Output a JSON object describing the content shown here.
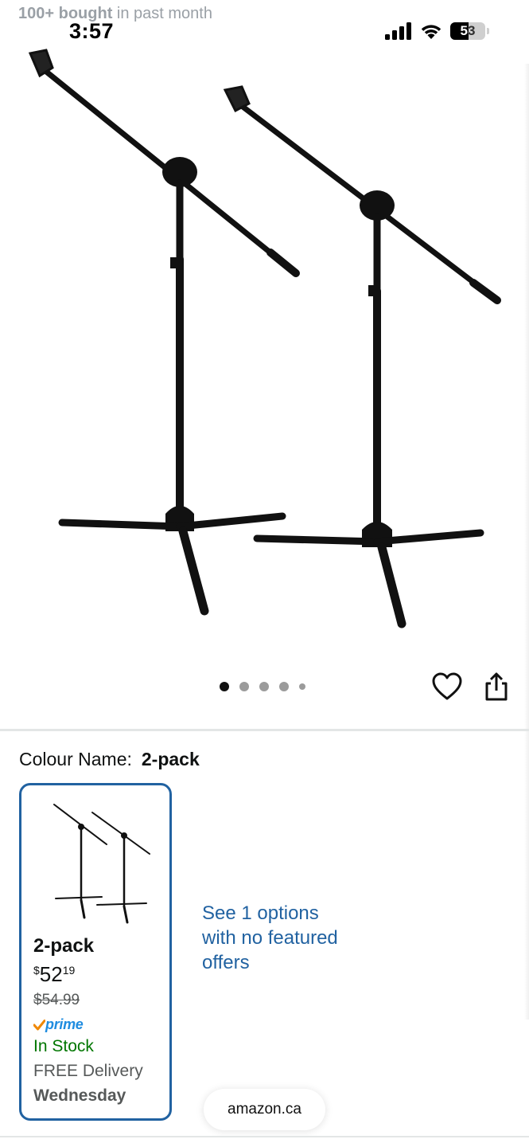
{
  "status_bar": {
    "time": "3:57",
    "battery": "53"
  },
  "social_proof": {
    "count": "100+ bought",
    "rest": " in past month"
  },
  "gallery": {
    "total_dots": 5,
    "active_index": 0
  },
  "variation": {
    "label": "Colour Name:",
    "value": "2-pack"
  },
  "swatch": {
    "name": "2-pack",
    "price_symbol": "$",
    "price_whole": "52",
    "price_fraction": "19",
    "old_price": "$54.99",
    "prime_label": "prime",
    "stock": "In Stock",
    "delivery": "FREE Delivery",
    "delivery_day": "Wednesday"
  },
  "other_options": {
    "text": "See 1 options with no featured offers"
  },
  "browser": {
    "url": "amazon.ca"
  },
  "colors": {
    "link": "#2162a1",
    "in_stock": "#007600",
    "prime": "#1f8ce0",
    "prime_check": "#f08804"
  },
  "icons": [
    "signal-icon",
    "wifi-icon",
    "battery-icon",
    "heart-icon",
    "share-icon",
    "prime-check-icon"
  ]
}
